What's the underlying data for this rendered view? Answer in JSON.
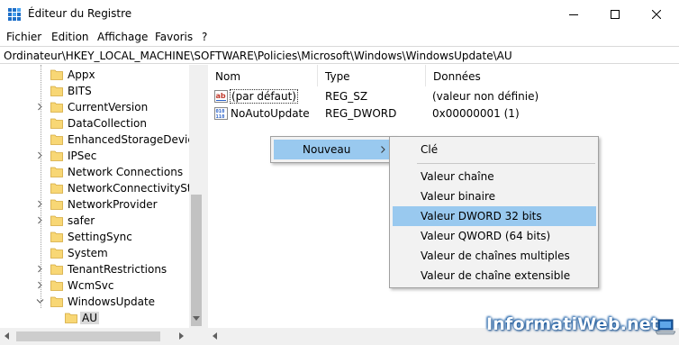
{
  "window": {
    "title": "Éditeur du Registre"
  },
  "menu": [
    "Fichier",
    "Edition",
    "Affichage",
    "Favoris",
    "?"
  ],
  "address": {
    "path": "Ordinateur\\HKEY_LOCAL_MACHINE\\SOFTWARE\\Policies\\Microsoft\\Windows\\WindowsUpdate\\AU"
  },
  "tree": {
    "items": [
      {
        "label": "Appx",
        "expandable": false
      },
      {
        "label": "BITS",
        "expandable": false
      },
      {
        "label": "CurrentVersion",
        "expandable": true
      },
      {
        "label": "DataCollection",
        "expandable": false
      },
      {
        "label": "EnhancedStorageDevices",
        "expandable": false
      },
      {
        "label": "IPSec",
        "expandable": true
      },
      {
        "label": "Network Connections",
        "expandable": false
      },
      {
        "label": "NetworkConnectivityStat",
        "expandable": false
      },
      {
        "label": "NetworkProvider",
        "expandable": true
      },
      {
        "label": "safer",
        "expandable": true
      },
      {
        "label": "SettingSync",
        "expandable": false
      },
      {
        "label": "System",
        "expandable": false
      },
      {
        "label": "TenantRestrictions",
        "expandable": true
      },
      {
        "label": "WcmSvc",
        "expandable": true
      },
      {
        "label": "WindowsUpdate",
        "expandable": true,
        "expanded": true
      },
      {
        "label": "AU",
        "selected": true,
        "child": true
      }
    ]
  },
  "values": {
    "columns": [
      "Nom",
      "Type",
      "Données"
    ],
    "rows": [
      {
        "name": "(par défaut)",
        "type": "REG_SZ",
        "data": "(valeur non définie)",
        "icon": "string-value-icon"
      },
      {
        "name": "NoAutoUpdate",
        "type": "REG_DWORD",
        "data": "0x00000001 (1)",
        "icon": "binary-value-icon"
      }
    ]
  },
  "context_menu": {
    "label": "Nouveau"
  },
  "submenu": {
    "items": [
      {
        "label": "Clé"
      },
      {
        "label": "Valeur chaîne"
      },
      {
        "label": "Valeur binaire"
      },
      {
        "label": "Valeur DWORD 32 bits",
        "highlighted": true
      },
      {
        "label": "Valeur QWORD (64 bits)"
      },
      {
        "label": "Valeur de chaînes multiples"
      },
      {
        "label": "Valeur de chaîne extensible"
      }
    ]
  },
  "watermark": {
    "text": "InformatiWeb.net"
  },
  "colors": {
    "highlight": "#99c9ef",
    "folder": "#f8d775",
    "menu_bg": "#f2f2f2"
  }
}
